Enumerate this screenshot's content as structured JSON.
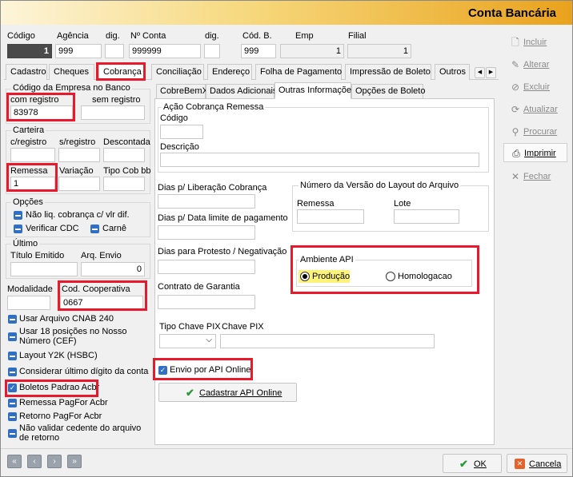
{
  "window": {
    "title": "Conta Bancária"
  },
  "header": {
    "labels": {
      "codigo": "Código",
      "agencia": "Agência",
      "dig1": "dig.",
      "nconta": "Nº Conta",
      "dig2": "dig.",
      "codb": "Cód. B.",
      "emp": "Emp",
      "filial": "Filial"
    },
    "values": {
      "codigo": "1",
      "agencia": "999",
      "nconta": "999999",
      "codb": "999",
      "emp": "1",
      "filial": "1"
    }
  },
  "tabs": [
    "Cadastro",
    "Cheques",
    "Cobrança",
    "Conciliação",
    "Endereço",
    "Folha de Pagamento",
    "Impressão de Boleto",
    "Outros"
  ],
  "left": {
    "codigo_empresa_title": "Código da Empresa no Banco",
    "com_registro_label": "com registro",
    "com_registro_value": "83978",
    "sem_registro_label": "sem registro",
    "carteira_title": "Carteira",
    "creg_label": "c/registro",
    "sreg_label": "s/registro",
    "descontada_label": "Descontada",
    "remessa_label": "Remessa",
    "remessa_value": "1",
    "variacao_label": "Variação",
    "tipo_cob_label": "Tipo Cob bb",
    "opcoes_title": "Opções",
    "opt_nao_liq": "Não liq. cobrança c/ vlr dif.",
    "opt_verificar": "Verificar CDC",
    "opt_carne": "Carnê",
    "ultimo_title": "Último",
    "titulo_emitido_label": "Título Emitido",
    "arq_envio_label": "Arq. Envio",
    "arq_envio_value": "0",
    "modalidade_label": "Modalidade",
    "cod_coop_label": "Cod. Cooperativa",
    "cod_coop_value": "0667",
    "checks": [
      "Usar Arquivo CNAB 240",
      "Usar 18 posições no Nosso Número (CEF)",
      "Layout Y2K (HSBC)",
      "Considerar último dígito da conta",
      "Boletos Padrao Acbr",
      "Remessa PagFor Acbr",
      "Retorno PagFor Acbr",
      "Não validar cedente do arquivo de retorno"
    ]
  },
  "subtabs": [
    "CobreBemX",
    "Dados Adicionais",
    "Outras Informações",
    "Opções de Boleto"
  ],
  "right": {
    "acao_title": "Ação Cobrança Remessa",
    "codigo_label": "Código",
    "descricao_label": "Descrição",
    "dias_lib_label": "Dias p/ Liberação Cobrança",
    "dias_limite_label": "Dias p/ Data limite de pagamento",
    "dias_protesto_label": "Dias para Protesto / Negativação",
    "contrato_label": "Contrato de Garantia",
    "versao_title": "Número da Versão do Layout do Arquivo",
    "remessa_label": "Remessa",
    "lote_label": "Lote",
    "ambiente_title": "Ambiente API",
    "producao": "Produção",
    "homologacao": "Homologacao",
    "tipo_chave_label": "Tipo Chave PIX",
    "chave_label": "Chave PIX",
    "envio_api": "Envio por API Online",
    "cadastrar_btn": "Cadastrar API Online"
  },
  "sidebar": [
    "Incluir",
    "Alterar",
    "Excluir",
    "Atualizar",
    "Procurar",
    "Imprimir",
    "Fechar"
  ],
  "footer": {
    "ok": "OK",
    "cancel": "Cancela"
  },
  "colors": {
    "highlight": "#e8192c",
    "accent": "#2f6fc4",
    "title_gradient_end": "#e9a21c"
  }
}
